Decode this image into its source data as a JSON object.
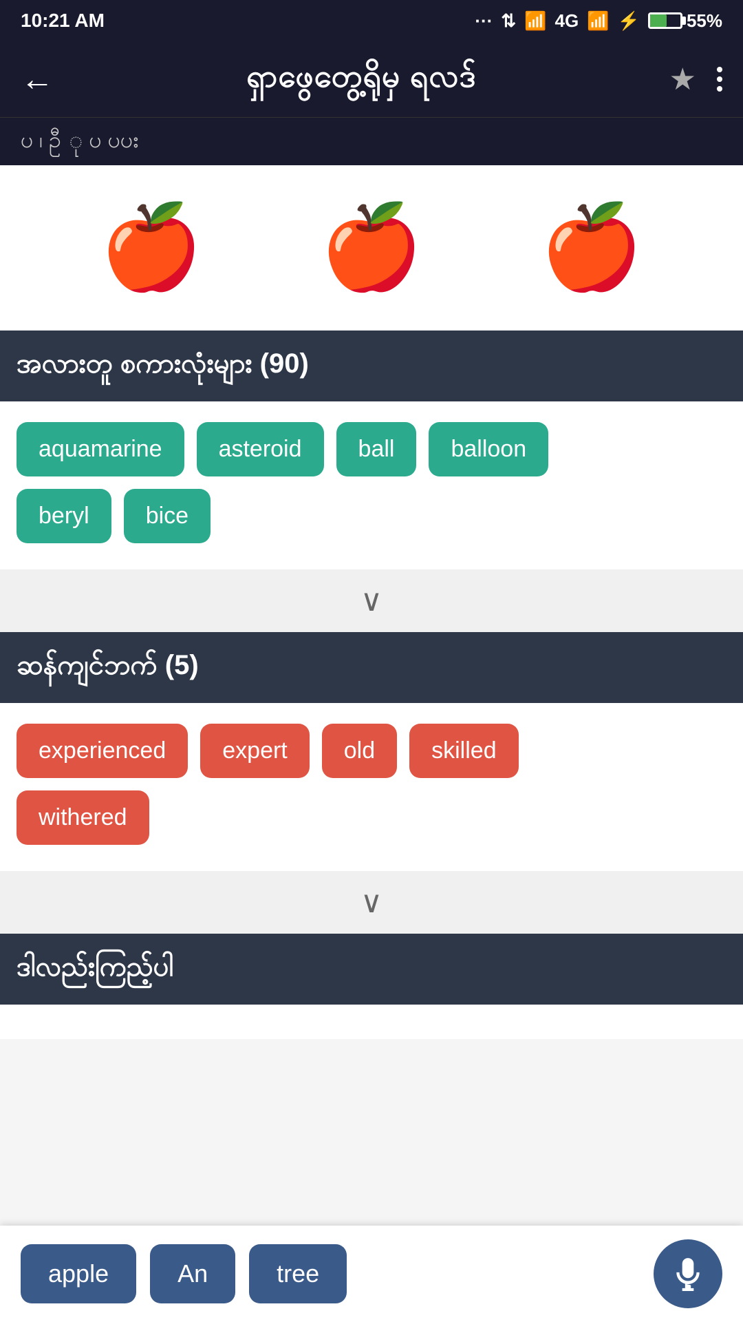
{
  "statusBar": {
    "time": "10:21 AM",
    "signal": "4G",
    "battery": "55%"
  },
  "header": {
    "back_label": "←",
    "title": "ရှာဖွေတွေ့ရိုမှ ရလဒ်",
    "star_label": "★",
    "menu_label": "⋮"
  },
  "subHeader": {
    "text": "ပ  ၊  ဦ  ု  ပ          ပပး"
  },
  "images": [
    {
      "alt": "apple-icon-1"
    },
    {
      "alt": "apple-icon-2"
    },
    {
      "alt": "apple-icon-3"
    }
  ],
  "relatedSection": {
    "title": "အလားတူ စကားလုံးများ (90)",
    "tags": [
      {
        "label": "aquamarine",
        "color": "teal"
      },
      {
        "label": "asteroid",
        "color": "teal"
      },
      {
        "label": "ball",
        "color": "teal"
      },
      {
        "label": "balloon",
        "color": "teal"
      },
      {
        "label": "beryl",
        "color": "teal"
      },
      {
        "label": "bice",
        "color": "teal"
      }
    ],
    "expand_label": "∨"
  },
  "synonymsSection": {
    "title": "ဆန်ကျင်ဘက် (5)",
    "tags": [
      {
        "label": "experienced",
        "color": "red"
      },
      {
        "label": "expert",
        "color": "red"
      },
      {
        "label": "old",
        "color": "red"
      },
      {
        "label": "skilled",
        "color": "red"
      },
      {
        "label": "withered",
        "color": "red"
      }
    ],
    "expand_label": "∨"
  },
  "relatedWordsSection": {
    "title": "ဒါလည်းကြည့်ပါ"
  },
  "bottomBar": {
    "tags": [
      {
        "label": "apple"
      },
      {
        "label": "An"
      },
      {
        "label": "tree"
      }
    ],
    "mic_label": "🎤"
  }
}
